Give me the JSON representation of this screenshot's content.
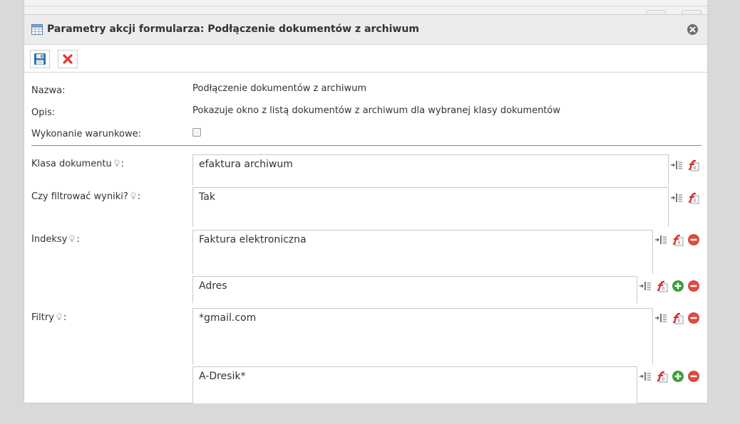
{
  "window": {
    "title": "Parametry akcji formularza: Podłączenie dokumentów z archiwum",
    "title_icon": "table-icon",
    "close_icon": "close-circle-icon"
  },
  "toolbar": {
    "save_icon": "floppy-disk-icon",
    "cancel_icon": "red-x-icon"
  },
  "info": {
    "name_label": "Nazwa:",
    "name_value": "Podłączenie dokumentów z archiwum",
    "description_label": "Opis:",
    "description_value": "Pokazuje okno z listą dokumentów z archiwum dla wybranej klasy dokumentów",
    "conditional_label": "Wykonanie warunkowe:",
    "conditional_checked": false
  },
  "params": {
    "klasa": {
      "label": "Klasa dokumentu",
      "value": "efaktura archiwum"
    },
    "filtrowac": {
      "label": "Czy filtrować wyniki?",
      "value": "Tak"
    },
    "indeksy": {
      "label": "Indeksy",
      "values": [
        "Faktura elektroniczna",
        "Adres"
      ]
    },
    "filtry": {
      "label": "Filtry",
      "values": [
        "*gmail.com",
        "A-Dresik*"
      ]
    },
    "colon": ":"
  },
  "colors": {
    "separator": "#6e8b99",
    "remove": "#e04a3f",
    "add": "#3aa33a",
    "formula": "#d9302c"
  }
}
